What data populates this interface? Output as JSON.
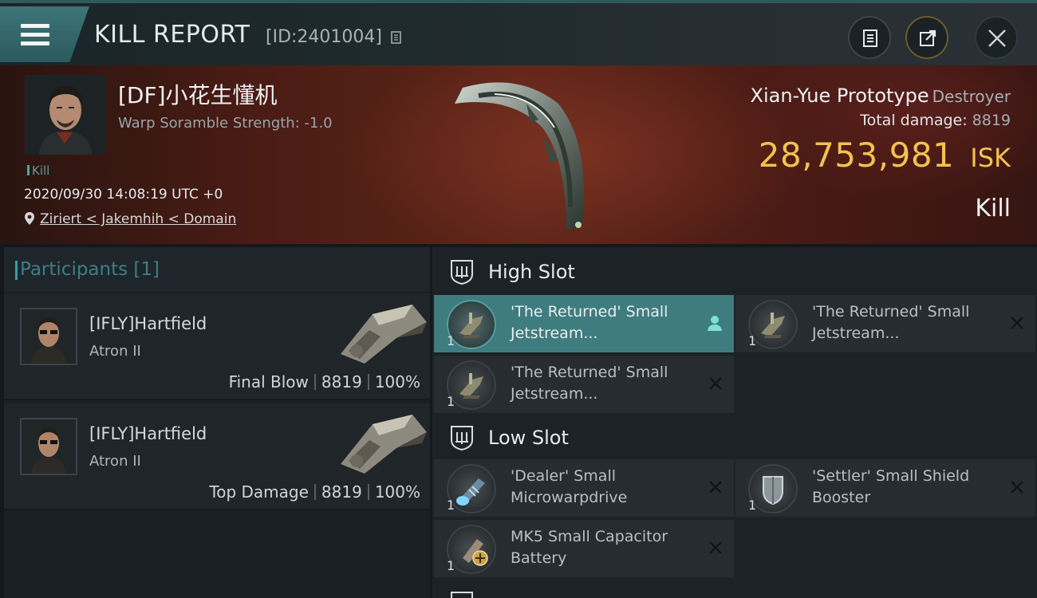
{
  "header": {
    "title": "KILL REPORT",
    "id_label": "[ID:2401004]",
    "buttons": {
      "report": "report-icon",
      "share": "share-icon",
      "close": "close-icon"
    }
  },
  "victim": {
    "name": "[DF]小花生懂机",
    "warp": "Warp Soramble Strength: -1.0",
    "kill_tag": "Kill",
    "datetime": "2020/09/30 14:08:19 UTC +0",
    "location": "Ziriert < Jakemhih < Domain",
    "ship_name": "Xian-Yue Prototype",
    "ship_class": "Destroyer",
    "total_damage_label": "Total damage:",
    "total_damage": "8819",
    "isk_amount": "28,753,981",
    "isk_unit": "ISK",
    "result": "Kill"
  },
  "participants": {
    "label": "Participants [1]",
    "rows": [
      {
        "name": "[IFLY]Hartfield",
        "ship": "Atron II",
        "role": "Final Blow",
        "damage": "8819",
        "percent": "100%"
      },
      {
        "name": "[IFLY]Hartfield",
        "ship": "Atron II",
        "role": "Top Damage",
        "damage": "8819",
        "percent": "100%"
      }
    ]
  },
  "fittings": {
    "high_slot": {
      "label": "High Slot",
      "modules": [
        {
          "name": "'The Returned' Small Jetstream...",
          "qty": "1"
        },
        {
          "name": "'The Returned' Small Jetstream...",
          "qty": "1"
        },
        {
          "name": "'The Returned' Small Jetstream...",
          "qty": "1"
        }
      ]
    },
    "low_slot": {
      "label": "Low Slot",
      "modules": [
        {
          "name": "'Dealer' Small Microwarpdrive",
          "qty": "1"
        },
        {
          "name": "'Settler' Small Shield Booster",
          "qty": "1"
        },
        {
          "name": "MK5 Small Capacitor Battery",
          "qty": "1"
        }
      ]
    }
  },
  "colors": {
    "accent_teal": "#3f7c7f",
    "isk_gold": "#f2c24e",
    "hero_red": "#5c2518"
  }
}
